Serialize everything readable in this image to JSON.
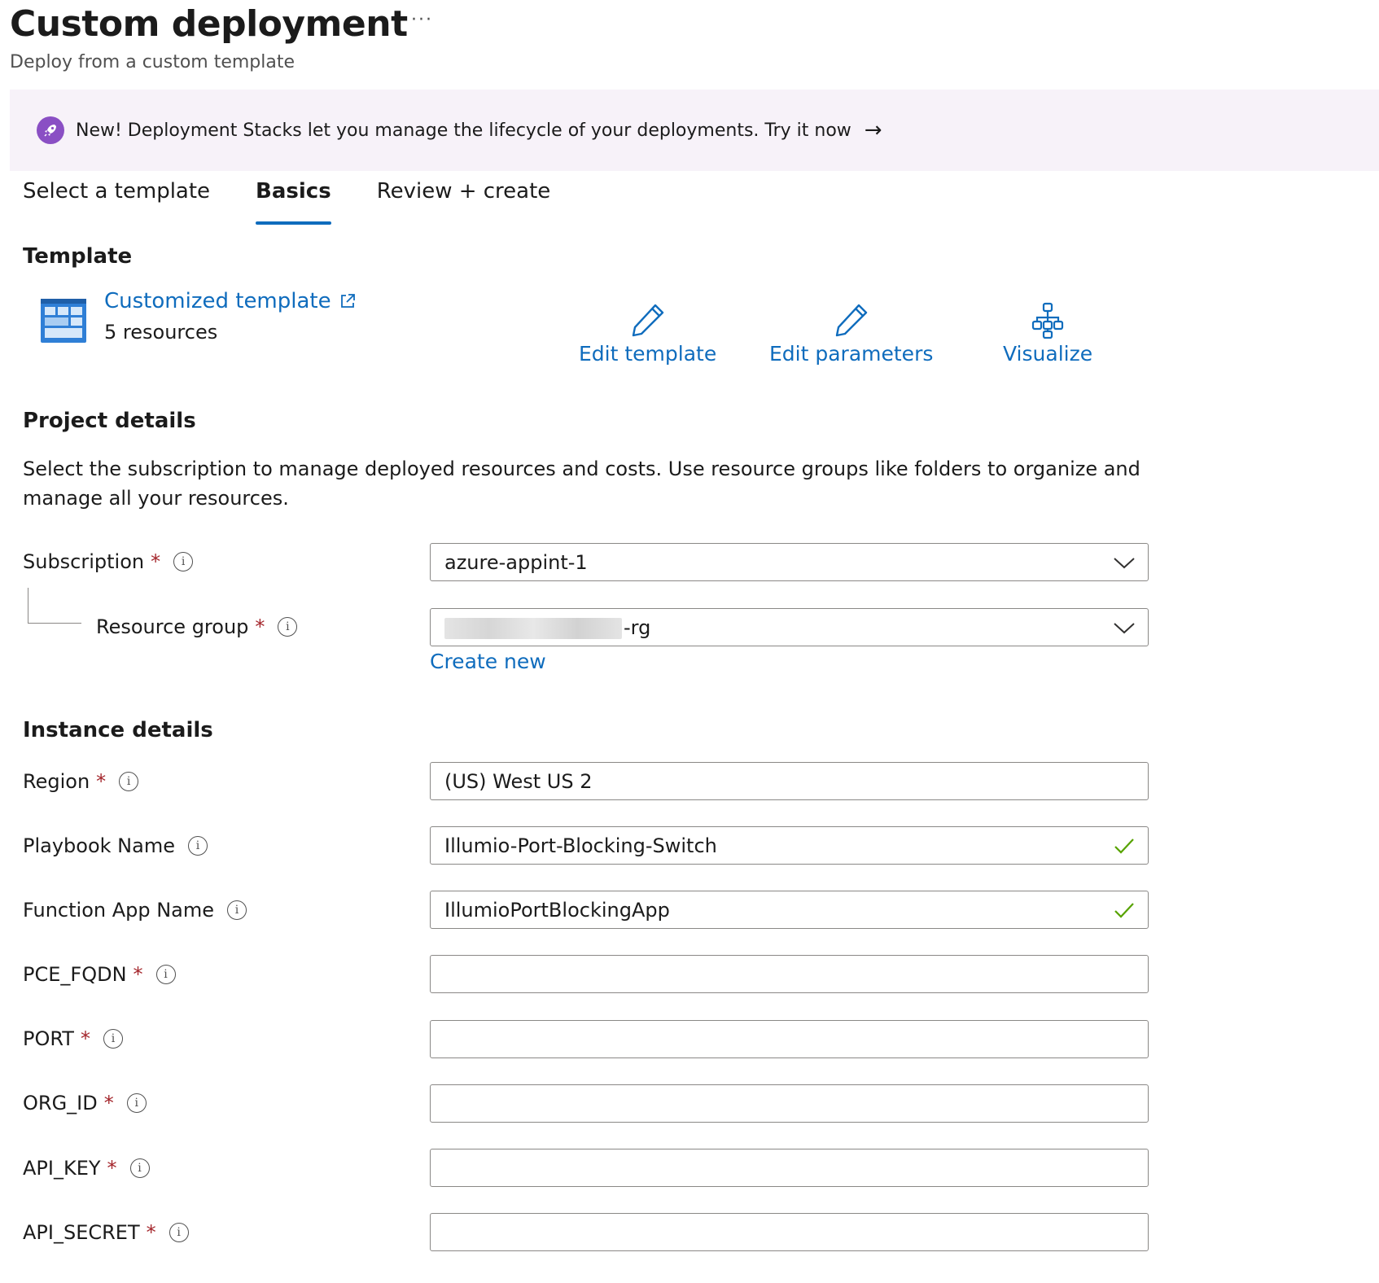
{
  "header": {
    "title": "Custom deployment",
    "more_label": "···",
    "subtitle": "Deploy from a custom template"
  },
  "banner": {
    "text": "New! Deployment Stacks let you manage the lifecycle of your deployments. Try it now",
    "arrow": "→",
    "icon": "rocket-icon"
  },
  "tabs": [
    {
      "label": "Select a template",
      "active": false
    },
    {
      "label": "Basics",
      "active": true
    },
    {
      "label": "Review + create",
      "active": false
    }
  ],
  "template": {
    "heading": "Template",
    "link_text": "Customized template",
    "resources": "5 resources",
    "actions": {
      "edit_template": "Edit template",
      "edit_parameters": "Edit parameters",
      "visualize": "Visualize"
    }
  },
  "project": {
    "heading": "Project details",
    "description": "Select the subscription to manage deployed resources and costs. Use resource groups like folders to organize and manage all your resources.",
    "subscription": {
      "label": "Subscription",
      "value": "azure-appint-1",
      "required": true
    },
    "resource_group": {
      "label": "Resource group",
      "value_suffix": "-rg",
      "required": true
    },
    "create_new": "Create new"
  },
  "instance": {
    "heading": "Instance details",
    "region": {
      "label": "Region",
      "value": "(US) West US 2"
    },
    "playbook_name": {
      "label": "Playbook Name",
      "value": "Illumio-Port-Blocking-Switch"
    },
    "function_app_name": {
      "label": "Function App Name",
      "value": "IllumioPortBlockingApp"
    },
    "pce_fqdn": {
      "label": "PCE_FQDN",
      "value": ""
    },
    "port": {
      "label": "PORT",
      "value": ""
    },
    "org_id": {
      "label": "ORG_ID",
      "value": ""
    },
    "api_key": {
      "label": "API_KEY",
      "value": ""
    },
    "api_secret": {
      "label": "API_SECRET",
      "value": ""
    }
  },
  "common": {
    "required_mark": "*",
    "info_glyph": "i"
  },
  "colors": {
    "accent": "#0f6cbd",
    "required": "#a4262c",
    "success": "#57a300",
    "banner_bg": "#f7f2f9",
    "banner_icon": "#8a4fc4"
  }
}
